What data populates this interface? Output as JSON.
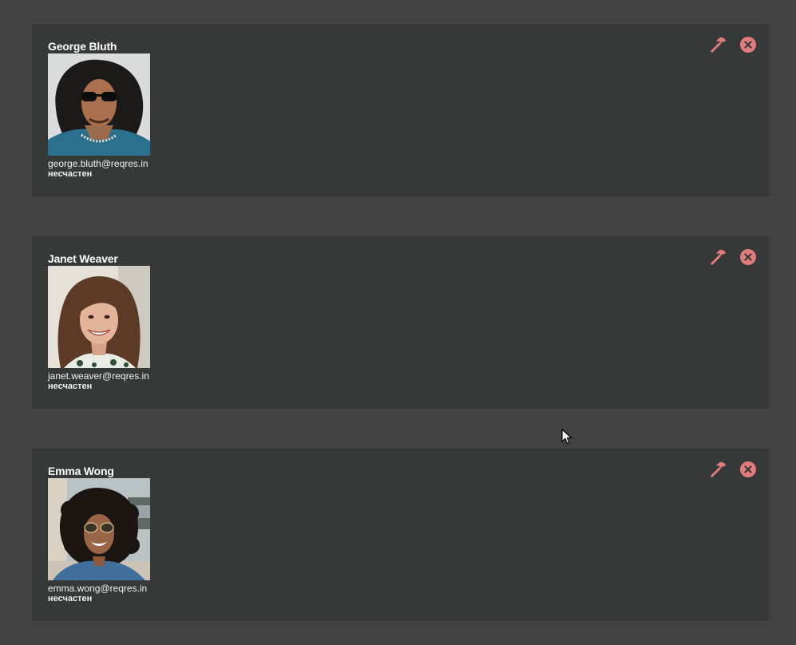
{
  "theme": {
    "background": "#424242",
    "card_background": "#353937",
    "accent": "#e07c7c",
    "text": "#ffffff"
  },
  "users": [
    {
      "name": "George Bluth",
      "email": "george.bluth@reqres.in",
      "status": "несчастен",
      "edit_icon": "hammer-icon",
      "delete_icon": "close-circle-icon"
    },
    {
      "name": "Janet Weaver",
      "email": "janet.weaver@reqres.in",
      "status": "несчастен",
      "edit_icon": "hammer-icon",
      "delete_icon": "close-circle-icon"
    },
    {
      "name": "Emma Wong",
      "email": "emma.wong@reqres.in",
      "status": "несчастен",
      "edit_icon": "hammer-icon",
      "delete_icon": "close-circle-icon"
    }
  ]
}
